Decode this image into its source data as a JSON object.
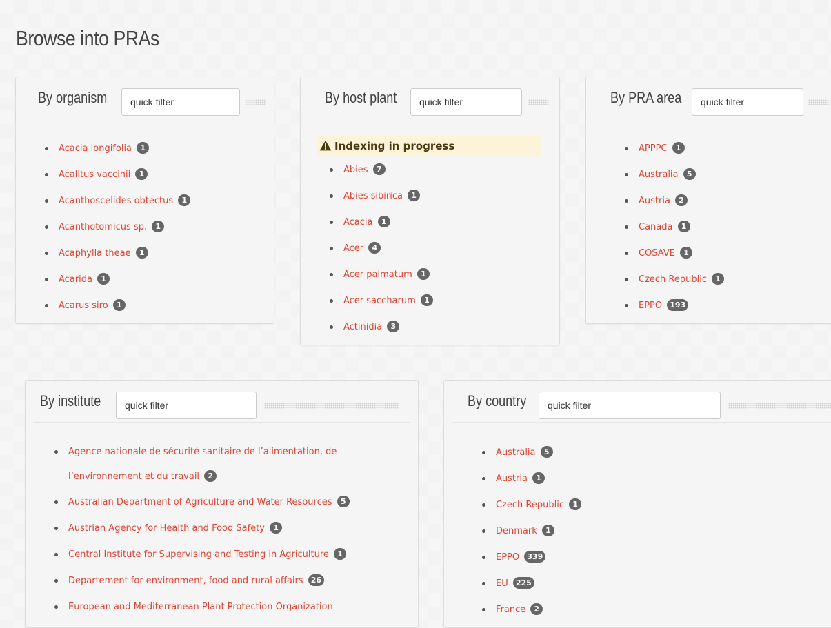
{
  "page": {
    "title": "Browse into PRAs"
  },
  "search": {
    "placeholder": "quick filter"
  },
  "organism": {
    "title": "By organism",
    "items": [
      {
        "label": "Acacia longifolia",
        "count": "1"
      },
      {
        "label": "Acalitus vaccinii",
        "count": "1"
      },
      {
        "label": "Acanthoscelides obtectus",
        "count": "1"
      },
      {
        "label": "Acanthotomicus sp.",
        "count": "1"
      },
      {
        "label": "Acaphylla theae",
        "count": "1"
      },
      {
        "label": "Acarida",
        "count": "1"
      },
      {
        "label": "Acarus siro",
        "count": "1"
      }
    ]
  },
  "host_plant": {
    "title": "By host plant",
    "notice": "Indexing in progress",
    "notice_icon": "warning-triangle-icon",
    "items": [
      {
        "label": "Abies",
        "count": "7"
      },
      {
        "label": "Abies sibirica",
        "count": "1"
      },
      {
        "label": "Acacia",
        "count": "1"
      },
      {
        "label": "Acer",
        "count": "4"
      },
      {
        "label": "Acer palmatum",
        "count": "1"
      },
      {
        "label": "Acer saccharum",
        "count": "1"
      },
      {
        "label": "Actinidia",
        "count": "3"
      }
    ]
  },
  "pra_area": {
    "title": "By PRA area",
    "items": [
      {
        "label": "APPPC",
        "count": "1"
      },
      {
        "label": "Australia",
        "count": "5"
      },
      {
        "label": "Austria",
        "count": "2"
      },
      {
        "label": "Canada",
        "count": "1"
      },
      {
        "label": "COSAVE",
        "count": "1"
      },
      {
        "label": "Czech Republic",
        "count": "1"
      },
      {
        "label": "EPPO",
        "count": "193"
      }
    ]
  },
  "institute": {
    "title": "By institute",
    "items": [
      {
        "label": "Agence nationale de sécurité sanitaire de l’alimentation, de l’environnement et du travail",
        "count": "2"
      },
      {
        "label": "Australian Department of Agriculture and Water Resources",
        "count": "5"
      },
      {
        "label": "Austrian Agency for Health and Food Safety",
        "count": "1"
      },
      {
        "label": "Central Institute for Supervising and Testing in Agriculture",
        "count": "1"
      },
      {
        "label": "Departement for environment, food and rural affairs",
        "count": "26"
      },
      {
        "label": "European and Mediterranean Plant Protection Organization",
        "count": ""
      }
    ]
  },
  "country": {
    "title": "By country",
    "items": [
      {
        "label": "Australia",
        "count": "5"
      },
      {
        "label": "Austria",
        "count": "1"
      },
      {
        "label": "Czech Republic",
        "count": "1"
      },
      {
        "label": "Denmark",
        "count": "1"
      },
      {
        "label": "EPPO",
        "count": "339"
      },
      {
        "label": "EU",
        "count": "225"
      },
      {
        "label": "France",
        "count": "2"
      }
    ]
  },
  "colors": {
    "link": "#dd4433",
    "badge": "#666666",
    "notice_bg": "#fcf3d9",
    "panel_bg": "#f5f5f5"
  }
}
